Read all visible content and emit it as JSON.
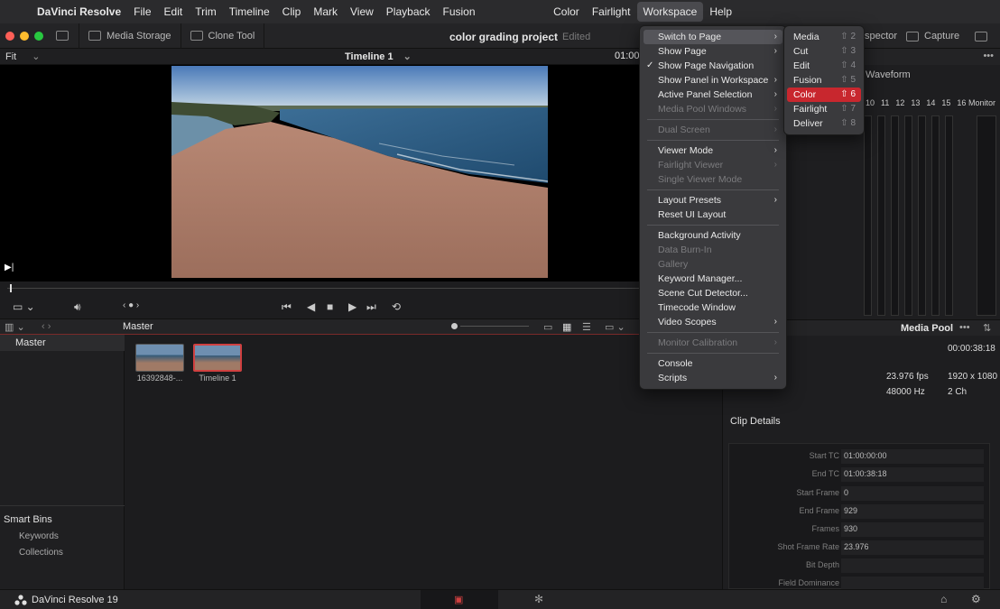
{
  "menubar": {
    "app_name": "DaVinci Resolve",
    "items": [
      "File",
      "Edit",
      "Trim",
      "Timeline",
      "Clip",
      "Mark",
      "View",
      "Playback",
      "Fusion"
    ],
    "right_items": [
      "Color",
      "Fairlight",
      "Workspace",
      "Help"
    ]
  },
  "toolbar": {
    "media_storage": "Media Storage",
    "clone_tool": "Clone Tool",
    "project_title": "color grading project",
    "edited": "Edited",
    "inspector": "spector",
    "capture": "Capture"
  },
  "viewer": {
    "fit": "Fit",
    "timeline_name": "Timeline 1",
    "timecode": "01:00"
  },
  "media_pool_bar": {
    "master": "Master"
  },
  "bins": {
    "master": "Master",
    "smart_bins_title": "Smart Bins",
    "smart_bins": [
      "Keywords",
      "Collections"
    ]
  },
  "clips": [
    {
      "label": "16392848-..."
    },
    {
      "label": "Timeline 1"
    }
  ],
  "scopes": {
    "waveform_label": "Waveform",
    "numbers": [
      "10",
      "11",
      "12",
      "13",
      "14",
      "15",
      "16"
    ],
    "monitor_label": "Monitor"
  },
  "media_pool_panel": {
    "title": "Media Pool",
    "duration": "00:00:38:18",
    "fps": "23.976 fps",
    "resolution": "1920 x 1080",
    "audio_hz": "48000 Hz",
    "channels": "2 Ch",
    "clip_details_title": "Clip Details",
    "details": [
      {
        "label": "Start TC",
        "value": "01:00:00:00"
      },
      {
        "label": "End TC",
        "value": "01:00:38:18"
      },
      {
        "label": "Start Frame",
        "value": "0"
      },
      {
        "label": "End Frame",
        "value": "929"
      },
      {
        "label": "Frames",
        "value": "930"
      },
      {
        "label": "Shot Frame Rate",
        "value": "23.976"
      },
      {
        "label": "Bit Depth",
        "value": ""
      },
      {
        "label": "Field Dominance",
        "value": ""
      }
    ]
  },
  "workspace_menu": {
    "items": [
      {
        "label": "Switch to Page",
        "submenu": true,
        "state": "highlight"
      },
      {
        "label": "Show Page",
        "submenu": true
      },
      {
        "label": "Show Page Navigation",
        "checked": true
      },
      {
        "label": "Show Panel in Workspace",
        "submenu": true
      },
      {
        "label": "Active Panel Selection",
        "submenu": true
      },
      {
        "label": "Media Pool Windows",
        "submenu": true,
        "disabled": true
      },
      {
        "separator": true
      },
      {
        "label": "Dual Screen",
        "submenu": true,
        "disabled": true
      },
      {
        "separator": true
      },
      {
        "label": "Viewer Mode",
        "submenu": true
      },
      {
        "label": "Fairlight Viewer",
        "submenu": true,
        "disabled": true
      },
      {
        "label": "Single Viewer Mode",
        "disabled": true
      },
      {
        "separator": true
      },
      {
        "label": "Layout Presets",
        "submenu": true
      },
      {
        "label": "Reset UI Layout"
      },
      {
        "separator": true
      },
      {
        "label": "Background Activity"
      },
      {
        "label": "Data Burn-In",
        "disabled": true
      },
      {
        "label": "Gallery",
        "disabled": true
      },
      {
        "label": "Keyword Manager..."
      },
      {
        "label": "Scene Cut Detector..."
      },
      {
        "label": "Timecode Window"
      },
      {
        "label": "Video Scopes",
        "submenu": true
      },
      {
        "separator": true
      },
      {
        "label": "Monitor Calibration",
        "submenu": true,
        "disabled": true
      },
      {
        "separator": true
      },
      {
        "label": "Console"
      },
      {
        "label": "Scripts",
        "submenu": true
      }
    ]
  },
  "switch_submenu": {
    "items": [
      {
        "label": "Media",
        "shortcut": "⇧ 2"
      },
      {
        "label": "Cut",
        "shortcut": "⇧ 3"
      },
      {
        "label": "Edit",
        "shortcut": "⇧ 4"
      },
      {
        "label": "Fusion",
        "shortcut": "⇧ 5"
      },
      {
        "label": "Color",
        "shortcut": "⇧ 6",
        "selected": true
      },
      {
        "label": "Fairlight",
        "shortcut": "⇧ 7"
      },
      {
        "label": "Deliver",
        "shortcut": "⇧ 8"
      }
    ]
  },
  "bottombar": {
    "brand": "DaVinci Resolve 19"
  },
  "colors": {
    "accent_red": "#c8272e",
    "menu_bg": "#3a3a3d",
    "bg": "#1c1c1e"
  }
}
